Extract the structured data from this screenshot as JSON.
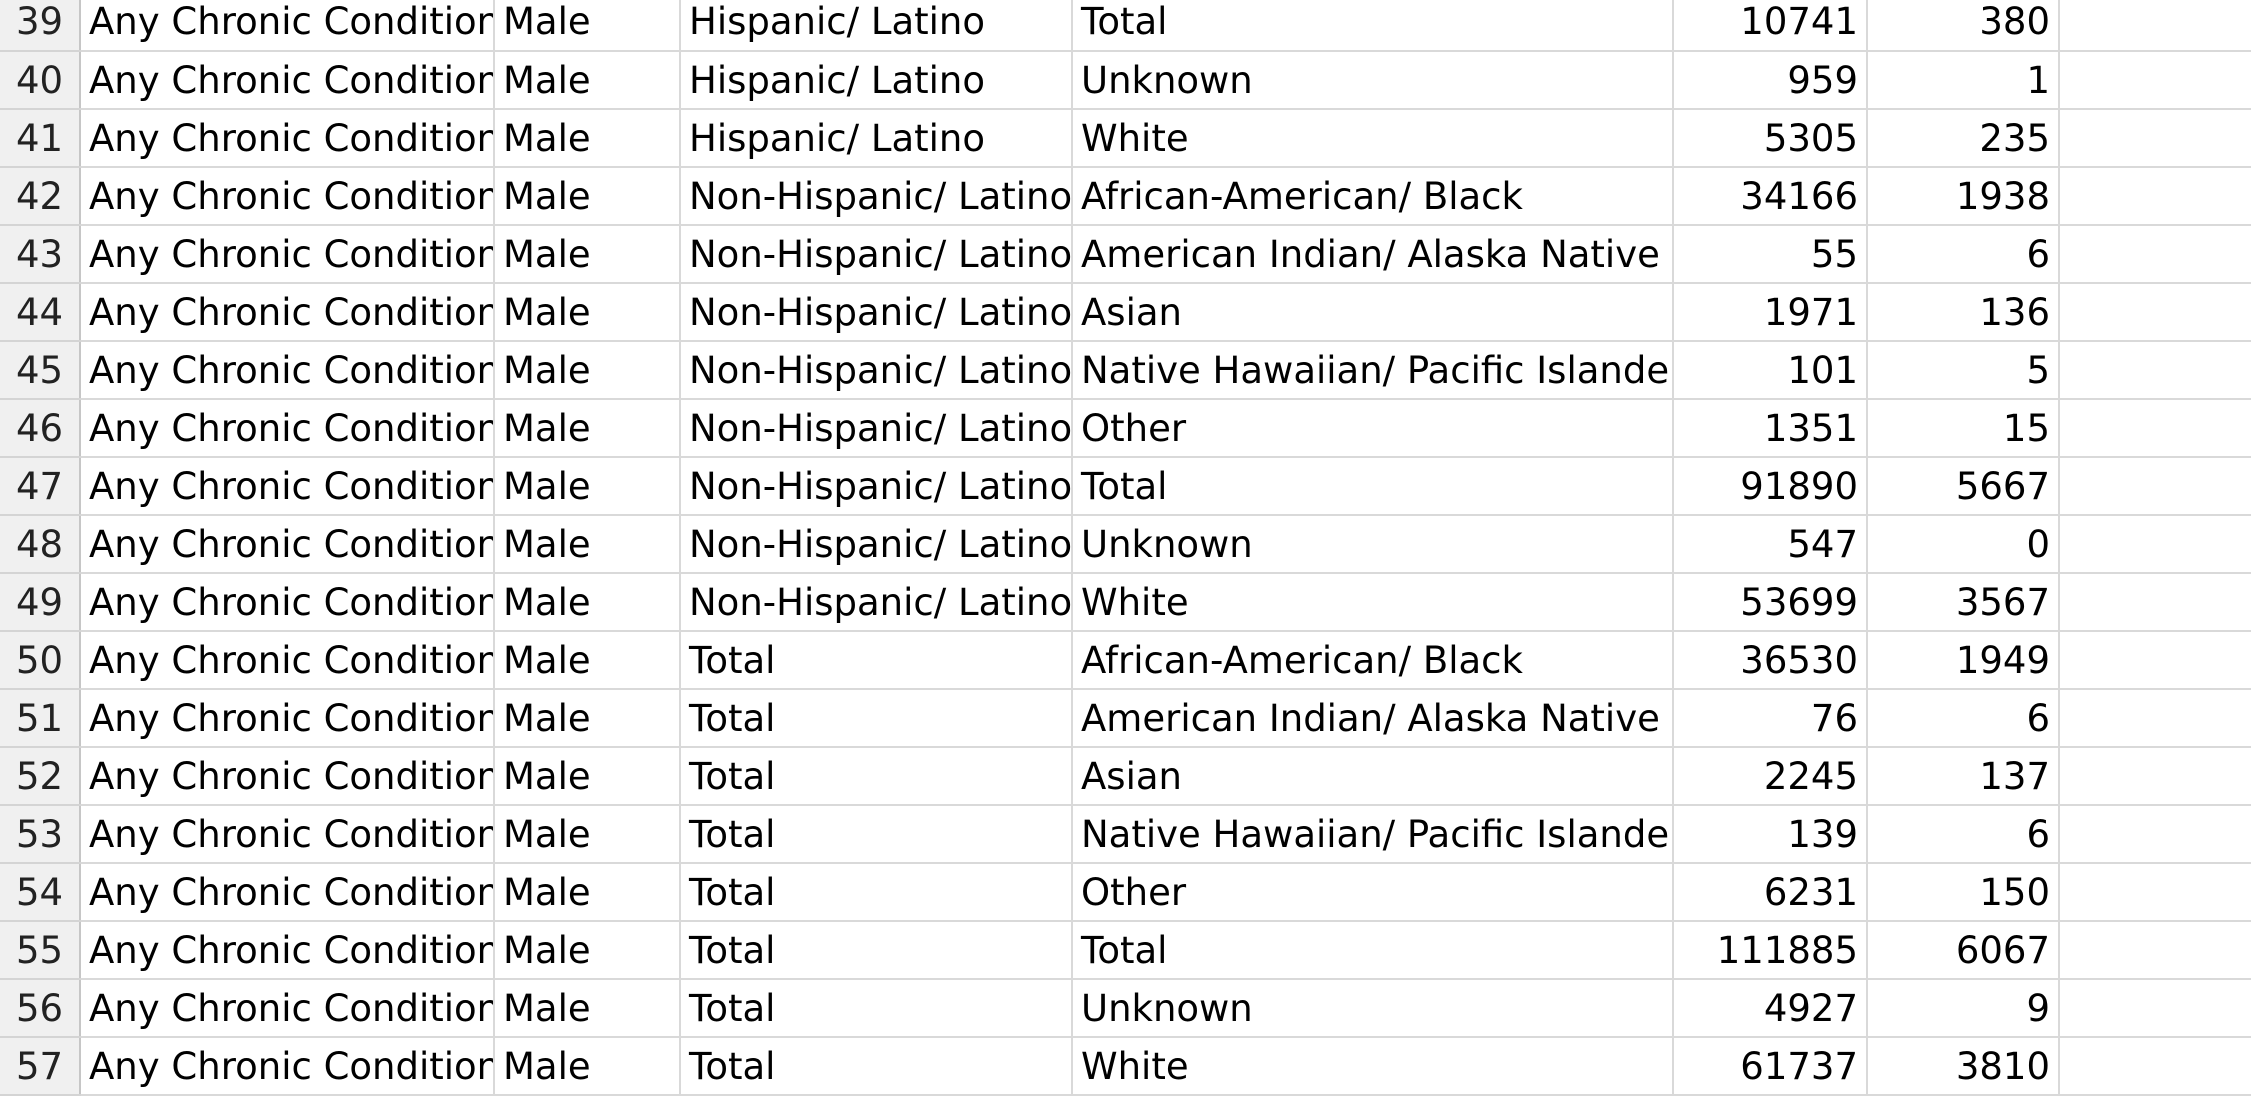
{
  "sheet": {
    "rows": [
      {
        "num": "39",
        "cells": [
          "Any Chronic Condition",
          "Male",
          "Hispanic/ Latino",
          "Total",
          "10741",
          "380"
        ]
      },
      {
        "num": "40",
        "cells": [
          "Any Chronic Condition",
          "Male",
          "Hispanic/ Latino",
          "Unknown",
          "959",
          "1"
        ]
      },
      {
        "num": "41",
        "cells": [
          "Any Chronic Condition",
          "Male",
          "Hispanic/ Latino",
          "White",
          "5305",
          "235"
        ]
      },
      {
        "num": "42",
        "cells": [
          "Any Chronic Condition",
          "Male",
          "Non-Hispanic/ Latino",
          "African-American/ Black",
          "34166",
          "1938"
        ]
      },
      {
        "num": "43",
        "cells": [
          "Any Chronic Condition",
          "Male",
          "Non-Hispanic/ Latino",
          "American Indian/ Alaska Native",
          "55",
          "6"
        ]
      },
      {
        "num": "44",
        "cells": [
          "Any Chronic Condition",
          "Male",
          "Non-Hispanic/ Latino",
          "Asian",
          "1971",
          "136"
        ]
      },
      {
        "num": "45",
        "cells": [
          "Any Chronic Condition",
          "Male",
          "Non-Hispanic/ Latino",
          "Native Hawaiian/ Pacific Islander",
          "101",
          "5"
        ]
      },
      {
        "num": "46",
        "cells": [
          "Any Chronic Condition",
          "Male",
          "Non-Hispanic/ Latino",
          "Other",
          "1351",
          "15"
        ]
      },
      {
        "num": "47",
        "cells": [
          "Any Chronic Condition",
          "Male",
          "Non-Hispanic/ Latino",
          "Total",
          "91890",
          "5667"
        ]
      },
      {
        "num": "48",
        "cells": [
          "Any Chronic Condition",
          "Male",
          "Non-Hispanic/ Latino",
          "Unknown",
          "547",
          "0"
        ]
      },
      {
        "num": "49",
        "cells": [
          "Any Chronic Condition",
          "Male",
          "Non-Hispanic/ Latino",
          "White",
          "53699",
          "3567"
        ]
      },
      {
        "num": "50",
        "cells": [
          "Any Chronic Condition",
          "Male",
          "Total",
          "African-American/ Black",
          "36530",
          "1949"
        ]
      },
      {
        "num": "51",
        "cells": [
          "Any Chronic Condition",
          "Male",
          "Total",
          "American Indian/ Alaska Native",
          "76",
          "6"
        ]
      },
      {
        "num": "52",
        "cells": [
          "Any Chronic Condition",
          "Male",
          "Total",
          "Asian",
          "2245",
          "137"
        ]
      },
      {
        "num": "53",
        "cells": [
          "Any Chronic Condition",
          "Male",
          "Total",
          "Native Hawaiian/ Pacific Islander",
          "139",
          "6"
        ]
      },
      {
        "num": "54",
        "cells": [
          "Any Chronic Condition",
          "Male",
          "Total",
          "Other",
          "6231",
          "150"
        ]
      },
      {
        "num": "55",
        "cells": [
          "Any Chronic Condition",
          "Male",
          "Total",
          "Total",
          "111885",
          "6067"
        ]
      },
      {
        "num": "56",
        "cells": [
          "Any Chronic Condition",
          "Male",
          "Total",
          "Unknown",
          "4927",
          "9"
        ]
      },
      {
        "num": "57",
        "cells": [
          "Any Chronic Condition",
          "Male",
          "Total",
          "White",
          "61737",
          "3810"
        ]
      }
    ]
  }
}
